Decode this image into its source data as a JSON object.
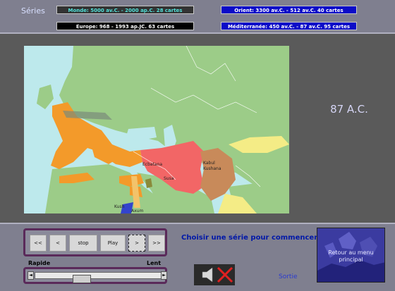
{
  "header": {
    "series_label": "Séries",
    "series_buttons": [
      "Monde: 5000 av.C. - 2000 ap.C. 28 cartes",
      "Orient: 3300 av.C. - 512 av.C. 40 cartes",
      "Europe: 968 - 1993 ap.JC. 63 cartes",
      "Méditerranée: 450 av.C. - 87 av.C. 95 cartes"
    ]
  },
  "map": {
    "year": "87 A.C.",
    "labels": {
      "ecbatana": "Ecbatana",
      "susa": "Susa",
      "kabul": "Kabul",
      "kushana": "Kushana",
      "kush": "Kush",
      "axum": "Axum"
    }
  },
  "controls": {
    "buttons": [
      "<<",
      "<",
      "stop",
      "Play",
      ">",
      ">>"
    ],
    "speed_fast": "Rapide",
    "speed_slow": "Lent",
    "slider_left": "◄",
    "slider_right": "►",
    "speed_value": 0.35
  },
  "status": {
    "choose": "Choisir une série pour commencer",
    "exit": "Sortie",
    "retour": "Retour au menu principal"
  },
  "colors": {
    "rome": "#f39a2a",
    "parthia": "#f26666",
    "kushan": "#c88a5a",
    "land": "#9ccc88",
    "sea": "#bde9ec",
    "steppe": "#f4ec86"
  }
}
